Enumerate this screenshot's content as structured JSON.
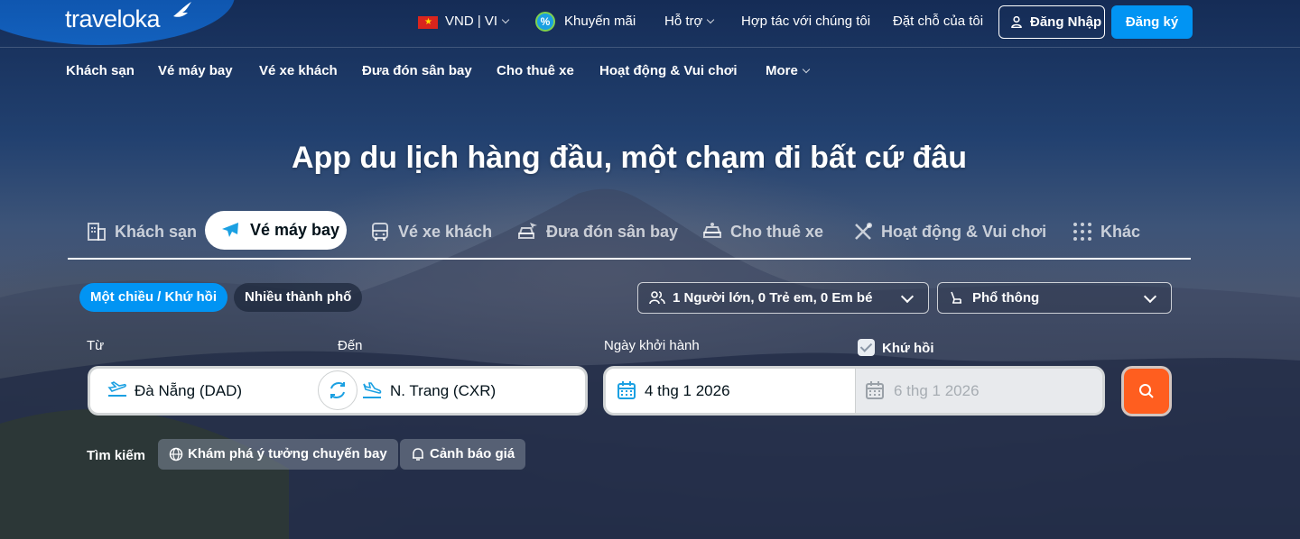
{
  "brand": {
    "logo": "traveloka"
  },
  "header": {
    "currency": "VND | VI",
    "promo": "Khuyến mãi",
    "support": "Hỗ trợ",
    "partner": "Hợp tác với chúng tôi",
    "bookings": "Đặt chỗ của tôi",
    "login": "Đăng Nhập",
    "register": "Đăng ký"
  },
  "subnav": {
    "items": [
      "Khách sạn",
      "Vé máy bay",
      "Vé xe khách",
      "Đưa đón sân bay",
      "Cho thuê xe",
      "Hoạt động & Vui chơi",
      "More"
    ]
  },
  "hero": {
    "title": "App du lịch hàng đầu, một chạm đi bất cứ đâu"
  },
  "product_tabs": {
    "active": "Vé máy bay",
    "items": [
      "Khách sạn",
      "Vé máy bay",
      "Vé xe khách",
      "Đưa đón sân bay",
      "Cho thuê xe",
      "Hoạt động & Vui chơi",
      "Khác"
    ]
  },
  "trip_type": {
    "one_way_round": "Một chiều / Khứ hồi",
    "multi_city": "Nhiều thành phố"
  },
  "passengers": {
    "value": "1 Người lớn, 0 Trẻ em, 0 Em bé"
  },
  "cabin": {
    "value": "Phổ thông"
  },
  "search_form": {
    "from_label": "Từ",
    "to_label": "Đến",
    "depart_label": "Ngày khởi hành",
    "return_label": "Khứ hồi",
    "return_checked": true,
    "from_value": "Đà Nẵng (DAD)",
    "to_value": "N. Trang (CXR)",
    "depart_value": "4 thg 1 2026",
    "return_value": "6 thg 1 2026"
  },
  "search_extras": {
    "label": "Tìm kiếm",
    "explore": "Khám phá ý tưởng chuyến bay",
    "price_alert": "Cảnh báo giá"
  },
  "colors": {
    "accent_blue": "#0194f3",
    "search_orange": "#ff5e1f",
    "flag_red": "#da251d"
  },
  "icons": [
    "flag-vn-icon",
    "promo-icon",
    "user-icon",
    "hotel-icon",
    "plane-icon",
    "bus-icon",
    "airport-transfer-icon",
    "car-rental-icon",
    "activities-icon",
    "more-grid-icon",
    "passengers-icon",
    "seat-icon",
    "takeoff-icon",
    "landing-icon",
    "swap-icon",
    "calendar-icon",
    "search-icon",
    "globe-icon",
    "bell-icon"
  ]
}
